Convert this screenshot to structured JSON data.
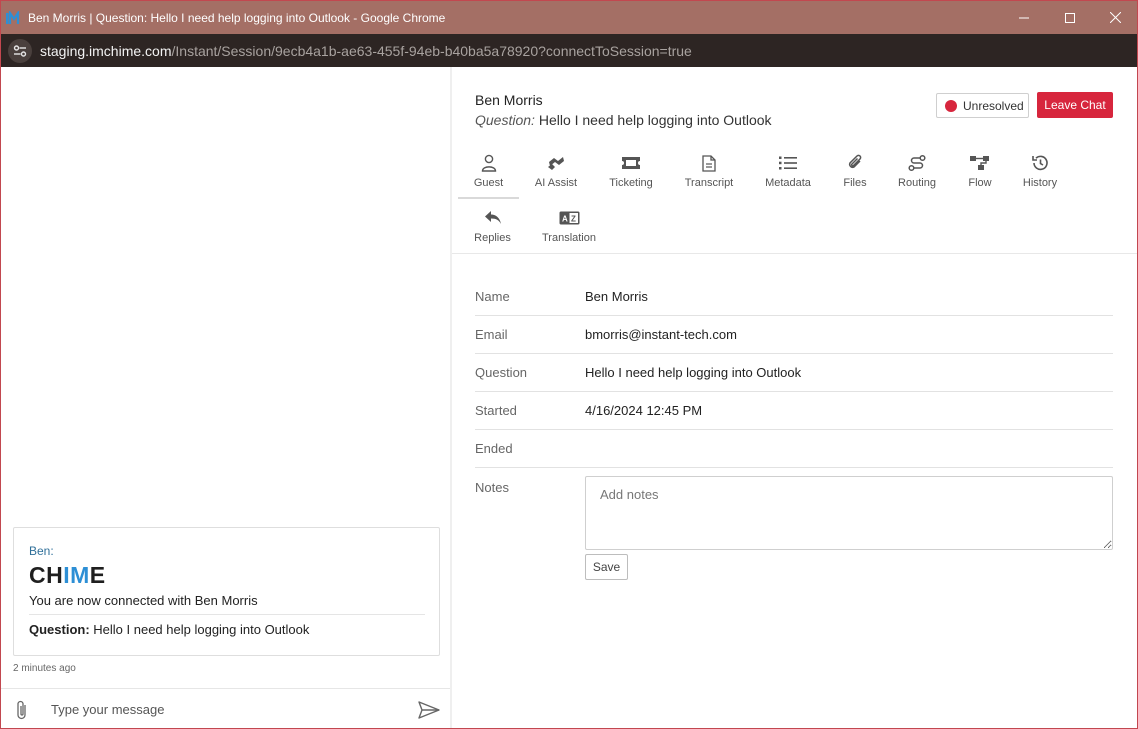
{
  "window": {
    "title": "Ben Morris | Question: Hello I need help logging into Outlook - Google Chrome",
    "url_host": "staging.imchime.com",
    "url_path": "/Instant/Session/9ecb4a1b-ae63-455f-94eb-b40ba5a78920?connectToSession=true"
  },
  "chat": {
    "sender": "Ben:",
    "logo_a": "CH",
    "logo_b": "IM",
    "logo_c": "E",
    "connected_text": "You are now connected with Ben Morris",
    "question_label": "Question:",
    "question_text": " Hello I need help logging into Outlook",
    "timestamp": "2 minutes ago",
    "compose_placeholder": "Type your message"
  },
  "header": {
    "guest_name": "Ben Morris",
    "question_label": "Question:",
    "question_text": " Hello I need help logging into Outlook",
    "status_label": "Unresolved",
    "status_color": "#d7263d",
    "leave_label": "Leave Chat"
  },
  "tabs": [
    {
      "label": "Guest",
      "icon": "person-icon"
    },
    {
      "label": "AI Assist",
      "icon": "ai-assist-icon"
    },
    {
      "label": "Ticketing",
      "icon": "ticket-icon"
    },
    {
      "label": "Transcript",
      "icon": "document-icon"
    },
    {
      "label": "Metadata",
      "icon": "list-icon"
    },
    {
      "label": "Files",
      "icon": "paperclip-icon"
    },
    {
      "label": "Routing",
      "icon": "routing-icon"
    },
    {
      "label": "Flow",
      "icon": "flow-icon"
    },
    {
      "label": "History",
      "icon": "history-icon"
    },
    {
      "label": "Replies",
      "icon": "reply-icon"
    },
    {
      "label": "Translation",
      "icon": "translation-icon"
    }
  ],
  "guest_info": {
    "rows": [
      {
        "label": "Name",
        "value": "Ben Morris"
      },
      {
        "label": "Email",
        "value": "bmorris@instant-tech.com"
      },
      {
        "label": "Question",
        "value": "Hello I need help logging into Outlook"
      },
      {
        "label": "Started",
        "value": "4/16/2024 12:45 PM"
      },
      {
        "label": "Ended",
        "value": ""
      }
    ],
    "notes_label": "Notes",
    "notes_placeholder": "Add notes",
    "save_label": "Save"
  }
}
